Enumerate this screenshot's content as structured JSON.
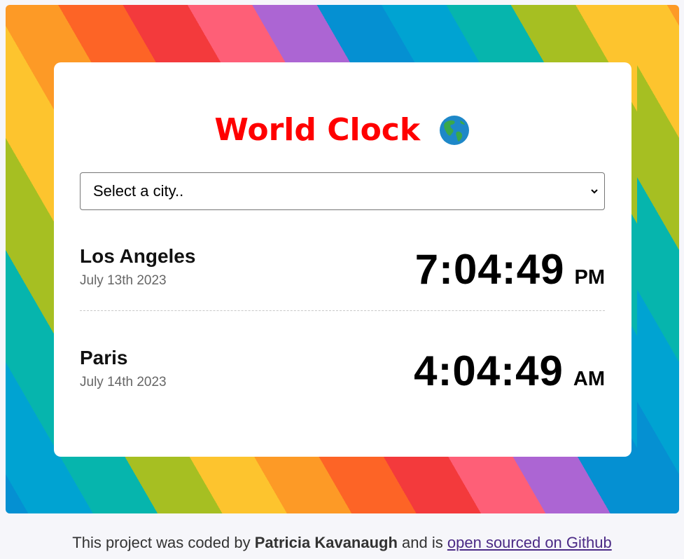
{
  "app": {
    "title": "World Clock"
  },
  "city_select": {
    "placeholder": "Select a city.."
  },
  "cities": [
    {
      "name": "Los Angeles",
      "date": "July 13th 2023",
      "time": "7:04:49",
      "ampm": "PM"
    },
    {
      "name": "Paris",
      "date": "July 14th 2023",
      "time": "4:04:49",
      "ampm": "AM"
    }
  ],
  "footer": {
    "prefix": "This project was coded by",
    "author": "Patricia Kavanaugh",
    "middle": "and is",
    "link_text": "open sourced on Github"
  },
  "colors": {
    "title": "#ff0000",
    "card": "#ffffff",
    "link": "#4b2a86",
    "rainbow": [
      "#0590d2",
      "#00a3d2",
      "#06b5ad",
      "#a6bf22",
      "#fdc42e",
      "#fd9a26",
      "#fd6426",
      "#f33a3c",
      "#fe5f77",
      "#ac65d3"
    ]
  },
  "icons": {
    "title_icon": "globe-americas-icon",
    "select_icon": "chevron-down-icon"
  }
}
